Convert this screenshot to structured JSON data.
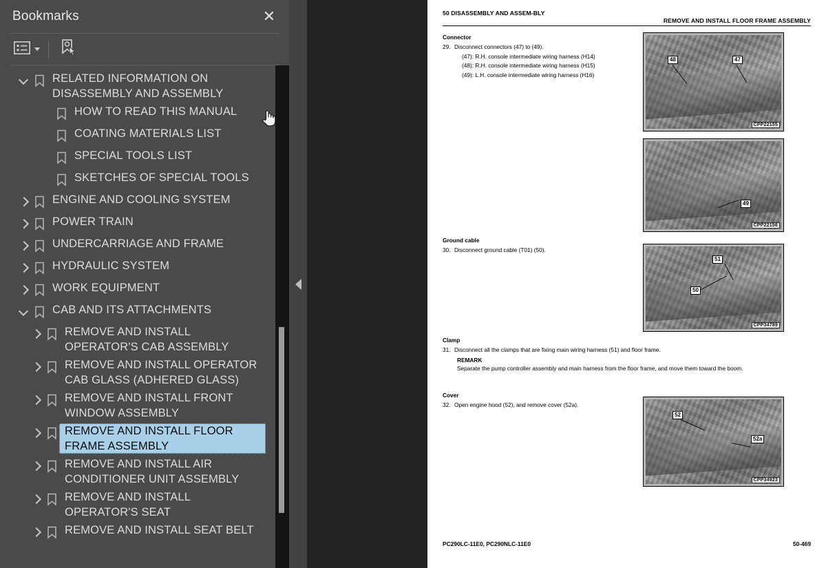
{
  "panel": {
    "title": "Bookmarks",
    "close_label": "✕",
    "toolbar": {
      "options_icon": "list-options-icon",
      "dropdown_icon": "chevron-down-icon",
      "new_bookmark_icon": "bookmark-pointer-icon"
    }
  },
  "bookmarks": [
    {
      "label": "RELATED INFORMATION ON DISASSEMBLY AND ASSEMBLY",
      "level": 0,
      "state": "expanded",
      "selected": false
    },
    {
      "label": "HOW TO READ THIS MANUAL",
      "level": 1,
      "state": "leaf",
      "selected": false
    },
    {
      "label": "COATING MATERIALS LIST",
      "level": 1,
      "state": "leaf",
      "selected": false
    },
    {
      "label": "SPECIAL TOOLS LIST",
      "level": 1,
      "state": "leaf",
      "selected": false
    },
    {
      "label": "SKETCHES OF SPECIAL TOOLS",
      "level": 1,
      "state": "leaf",
      "selected": false
    },
    {
      "label": "ENGINE AND COOLING SYSTEM",
      "level": 0,
      "state": "collapsed",
      "selected": false
    },
    {
      "label": "POWER TRAIN",
      "level": 0,
      "state": "collapsed",
      "selected": false
    },
    {
      "label": "UNDERCARRIAGE AND FRAME",
      "level": 0,
      "state": "collapsed",
      "selected": false
    },
    {
      "label": "HYDRAULIC SYSTEM",
      "level": 0,
      "state": "collapsed",
      "selected": false
    },
    {
      "label": "WORK EQUIPMENT",
      "level": 0,
      "state": "collapsed",
      "selected": false
    },
    {
      "label": "CAB AND ITS ATTACHMENTS",
      "level": 0,
      "state": "expanded",
      "selected": false
    },
    {
      "label": "REMOVE AND INSTALL OPERATOR'S CAB ASSEMBLY",
      "level": 2,
      "state": "collapsed",
      "selected": false
    },
    {
      "label": "REMOVE AND INSTALL OPERATOR CAB GLASS (ADHERED GLASS)",
      "level": 2,
      "state": "collapsed",
      "selected": false
    },
    {
      "label": "REMOVE AND INSTALL FRONT WINDOW ASSEMBLY",
      "level": 2,
      "state": "collapsed",
      "selected": false
    },
    {
      "label": "REMOVE AND INSTALL FLOOR FRAME ASSEMBLY",
      "level": 2,
      "state": "collapsed",
      "selected": true
    },
    {
      "label": "REMOVE AND INSTALL AIR CONDITIONER UNIT ASSEMBLY",
      "level": 2,
      "state": "collapsed",
      "selected": false
    },
    {
      "label": "REMOVE AND INSTALL OPERATOR'S SEAT",
      "level": 2,
      "state": "collapsed",
      "selected": false
    },
    {
      "label": "REMOVE AND INSTALL SEAT BELT",
      "level": 2,
      "state": "collapsed",
      "selected": false
    }
  ],
  "gutter": {
    "collapse_icon": "collapse-left-triangle-icon"
  },
  "document": {
    "header_left": "50 DISASSEMBLY AND ASSEM-BLY",
    "header_right": "REMOVE AND INSTALL FLOOR FRAME ASSEMBLY",
    "sections": [
      {
        "heading": "Connector",
        "step_number": "29.",
        "step_text": "Disconnect connectors (47) to (49).",
        "sublines": [
          "(47): R.H. console intermediate wiring harness (H14)",
          "(48): R.H. console intermediate wiring harness (H15)",
          "(49): L.H. console intermediate wiring harness (H16)"
        ]
      },
      {
        "heading": "Ground cable",
        "step_number": "30.",
        "step_text": "Disconnect ground cable (T01) (50).",
        "sublines": []
      },
      {
        "heading": "Clamp",
        "step_number": "31.",
        "step_text": "Disconnect all the clamps that are fixing main wiring harness (51) and floor frame.",
        "remark_title": "REMARK",
        "remark_text": "Separate the pump controller assembly and main harness from the floor frame, and move them toward the boom.",
        "sublines": []
      },
      {
        "heading": "Cover",
        "step_number": "32.",
        "step_text": "Open engine hood (52), and remove cover (52a).",
        "sublines": []
      }
    ],
    "figures": [
      {
        "code": "CPP22155",
        "callouts": [
          "48",
          "47"
        ]
      },
      {
        "code": "CPP22156",
        "callouts": [
          "49"
        ]
      },
      {
        "code": "CPP34789",
        "callouts": [
          "51",
          "50"
        ]
      },
      {
        "code": "CPP34923",
        "callouts": [
          "52",
          "52a"
        ]
      }
    ],
    "footer_left": "PC290LC-11E0, PC290NLC-11E0",
    "footer_right": "50-469"
  },
  "colors": {
    "panel_bg": "#4a4a4a",
    "selection": "#a8d0e8",
    "text": "#dcdcdc",
    "scrollbar_track": "#141414",
    "scrollbar_thumb": "#9a9a9a"
  }
}
